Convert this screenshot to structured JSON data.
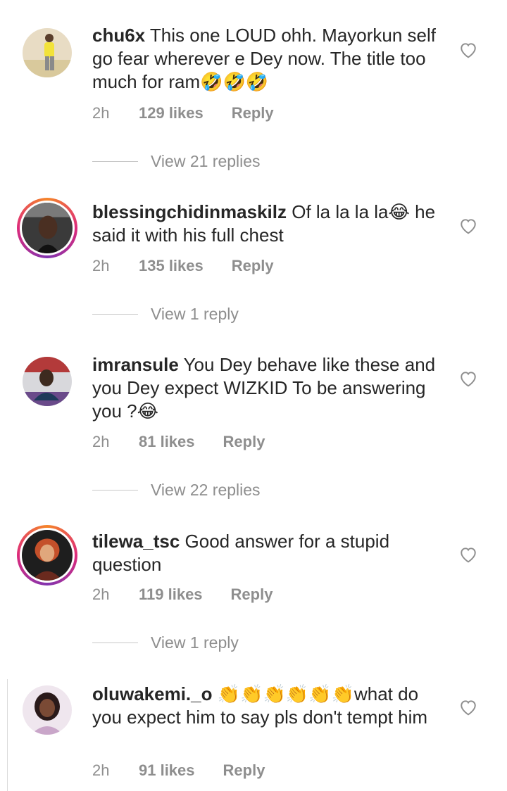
{
  "comments": [
    {
      "username": "chu6x",
      "text": "This one LOUD ohh. Mayorkun self go fear wherever e Dey now. The title too much for ram🤣🤣🤣",
      "time": "2h",
      "likes": "129 likes",
      "reply": "Reply",
      "view_replies": "View 21 replies",
      "avatar_icon": "profile-photo",
      "story_ring": false
    },
    {
      "username": "blessingchidinmaskilz",
      "text": "Of la la la la😂 he said it with his full chest",
      "time": "2h",
      "likes": "135 likes",
      "reply": "Reply",
      "view_replies": "View 1 reply",
      "avatar_icon": "profile-photo",
      "story_ring": true
    },
    {
      "username": "imransule",
      "text": "You Dey behave like these and you Dey expect WIZKID To be answering you ?😂",
      "time": "2h",
      "likes": "81 likes",
      "reply": "Reply",
      "view_replies": "View 22 replies",
      "avatar_icon": "profile-photo",
      "story_ring": false
    },
    {
      "username": "tilewa_tsc",
      "text": "Good answer for a stupid question",
      "time": "2h",
      "likes": "119 likes",
      "reply": "Reply",
      "view_replies": "View 1 reply",
      "avatar_icon": "profile-photo",
      "story_ring": true
    },
    {
      "username": "oluwakemi._o",
      "text": "👏👏👏👏👏👏what do you expect him to say pls don't tempt him",
      "time": "2h",
      "likes": "91 likes",
      "reply": "Reply",
      "avatar_icon": "profile-photo",
      "story_ring": false
    }
  ],
  "icons": {
    "like": "heart-outline-icon"
  },
  "colors": {
    "text": "#262626",
    "meta": "#8e8e8e",
    "story_ring": "#dd2a7b"
  }
}
